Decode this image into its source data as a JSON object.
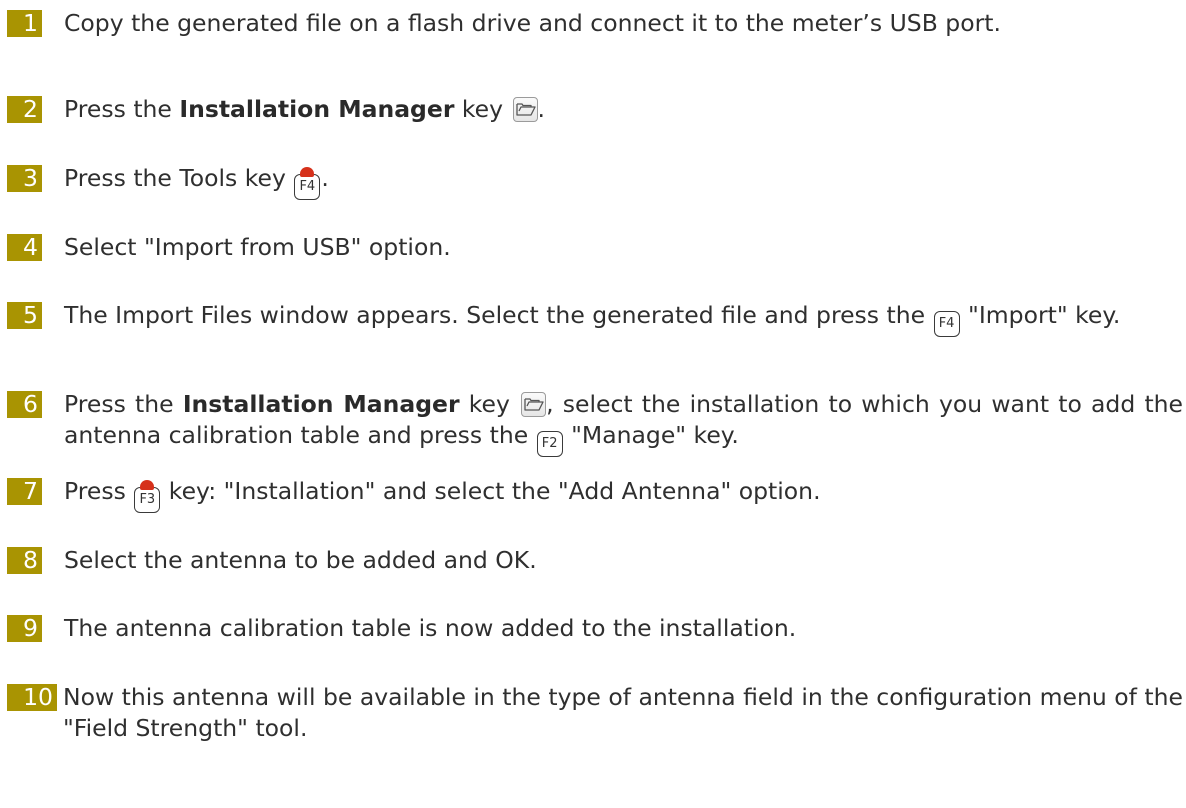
{
  "colors": {
    "number_badge": "#a99402",
    "badge_text": "#ffffff",
    "body_text": "#2f2f2f",
    "key_dot": "#d6311b"
  },
  "icons": {
    "installation_manager_key": "folder-icon",
    "function_key_marker": "red-dot"
  },
  "steps": [
    {
      "number": "1",
      "text": "Copy the generated file on a flash drive and connect it to the meter’s USB port."
    },
    {
      "number": "2",
      "text_before": "Press the ",
      "bold": "Installation Manager",
      "text_after": " key",
      "end": "."
    },
    {
      "number": "3",
      "text_before": "Press the Tools key ",
      "key": "F4",
      "end": "."
    },
    {
      "number": "4",
      "text": "Select \"Import from USB\" option."
    },
    {
      "number": "5",
      "text_before": "The Import Files window appears. Select the generated file and press the ",
      "key": "F4",
      "text_after": " \"Import\" key."
    },
    {
      "number": "6",
      "text_before": "Press the ",
      "bold": "Installation Manager",
      "text_mid": " key ",
      "text_mid2": ", select the installation to which you want to add the antenna calibration table and press the ",
      "key": "F2",
      "text_after": " \"Manage\" key."
    },
    {
      "number": "7",
      "text_before": "Press ",
      "key": "F3",
      "text_after": " key: \"Installation\" and select the \"Add Antenna\" option."
    },
    {
      "number": "8",
      "text": "Select the antenna to be added and OK."
    },
    {
      "number": "9",
      "text": "The antenna calibration table is now added to the installation."
    },
    {
      "number": "10",
      "text": "Now this antenna will be available in the type of antenna field in the configuration menu of the \"Field Strength\" tool."
    }
  ]
}
